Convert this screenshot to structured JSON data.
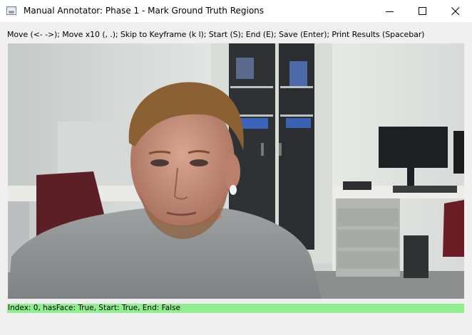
{
  "window": {
    "title": "Manual Annotator: Phase 1 - Mark Ground Truth Regions",
    "icon": "app-window-icon",
    "controls": [
      "minimize-icon",
      "maximize-icon",
      "close-icon"
    ]
  },
  "instructions": "Move (<- ->); Move x10 (, .); Skip to Keyframe (k l); Start (S); End (E); Save (Enter); Print Results (Spacebar)",
  "frame": {
    "description_icon": "video-frame"
  },
  "status": {
    "text": "Index: 0, hasFace: True, Start: True, End: False",
    "color": "#90ee90"
  }
}
